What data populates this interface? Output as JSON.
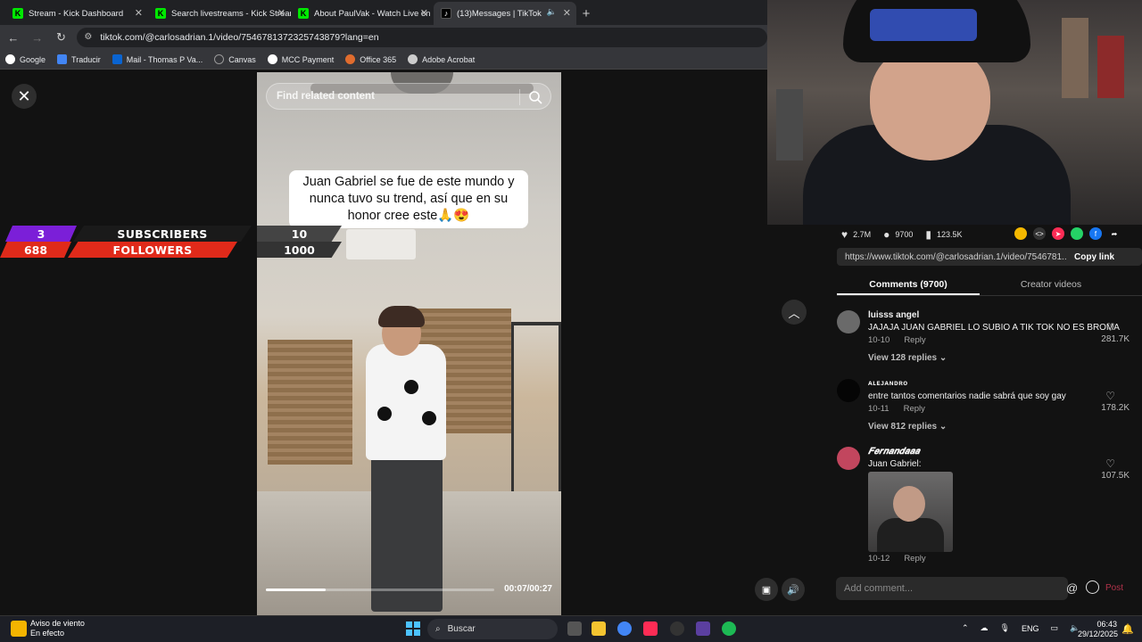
{
  "browser": {
    "tabs": [
      {
        "title": "Stream - Kick Dashboard",
        "icon": "kick-icon",
        "active": false
      },
      {
        "title": "Search livestreams - Kick Stream",
        "icon": "kick-icon",
        "active": false
      },
      {
        "title": "About PaulVak - Watch Live on",
        "icon": "kick-icon",
        "active": false
      },
      {
        "title": "(13)Messages | TikTok",
        "icon": "tiktok-icon",
        "active": true
      }
    ],
    "new_tab_label": "+",
    "url": "tiktok.com/@carlosadrian.1/video/7546781372325743879?lang=en",
    "bookmarks": [
      "Google",
      "Traducir",
      "Mail - Thomas P Va...",
      "Canvas",
      "MCC Payment",
      "Office 365",
      "Adobe Acrobat"
    ]
  },
  "video": {
    "search_placeholder": "Find related content",
    "caption": "Juan Gabriel se fue de este mundo y nunca tuvo su trend, así que en su honor cree este🙏😍",
    "time": "00:07/00:27",
    "progress": 0.26
  },
  "overlay": {
    "subscribers_count": "3",
    "subscribers_label": "SUBSCRIBERS",
    "subscribers_goal": "10",
    "followers_count": "688",
    "followers_label": "FOLLOWERS",
    "followers_goal": "1000"
  },
  "panel": {
    "likes": "2.7M",
    "comments_count": "9700",
    "saves": "123.5K",
    "share_url": "https://www.tiktok.com/@carlosadrian.1/video/7546781...",
    "copy_link": "Copy link",
    "tab_comments": "Comments (9700)",
    "tab_creator": "Creator videos",
    "comments": [
      {
        "user": "luisss angel",
        "text": "JAJAJA JUAN GABRIEL LO SUBIO A TIK TOK NO ES BROMA",
        "date": "10-10",
        "reply": "Reply",
        "likes": "281.7K",
        "view_replies": "View 128 replies"
      },
      {
        "user": "ᴀʟᴇᴊᴀɴᴅʀᴏ",
        "text": "entre tantos comentarios nadie sabrá que soy gay",
        "date": "10-11",
        "reply": "Reply",
        "likes": "178.2K",
        "view_replies": "View 812 replies"
      },
      {
        "user": "𝑭𝒆𝒓𝒏𝒂𝒏𝒅𝒂𝒂𝒂",
        "text": "Juan Gabriel:",
        "date": "10-12",
        "reply": "Reply",
        "likes": "107.5K"
      }
    ],
    "add_comment_placeholder": "Add comment...",
    "at_symbol": "@",
    "post_label": "Post"
  },
  "taskbar": {
    "weather_title": "Aviso de viento",
    "weather_sub": "En efecto",
    "search_label": "Buscar",
    "lang": "ENG",
    "time": "06:43",
    "date": "29/12/2025"
  }
}
